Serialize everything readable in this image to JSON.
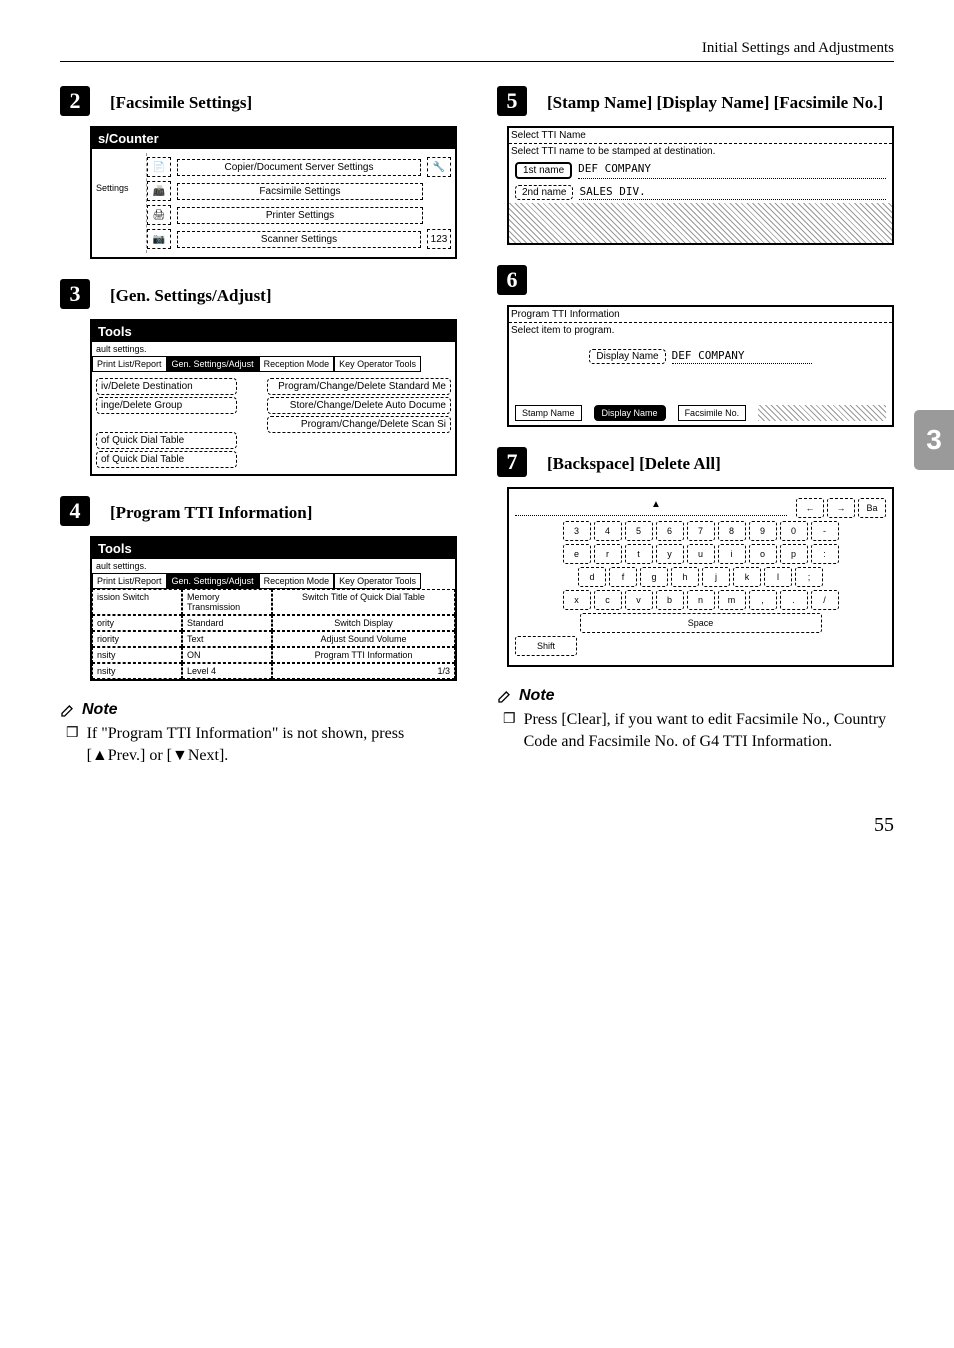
{
  "header": "Initial Settings and Adjustments",
  "side_tab": "3",
  "pagenum": "55",
  "left": {
    "step2": {
      "label": "[Facsimile Settings]"
    },
    "step3": {
      "label": "[Gen. Settings/Adjust]"
    },
    "step4": {
      "label": "[Program TTI Information]"
    },
    "note_title": "Note",
    "note_text": "If \"Program TTI Information\" is not shown, press [▲Prev.] or [▼Next]."
  },
  "right": {
    "step5": {
      "label": "[Stamp Name]  [Display Name]  [Facsimile No.]"
    },
    "step7": {
      "label": "[Backspace]     [Delete All]"
    },
    "note_title": "Note",
    "note_text": "Press [Clear], if you want to edit Facsimile No., Country Code and Facsimile No. of G4 TTI Information."
  },
  "panel_counter": {
    "title": "s/Counter",
    "sidetab": "Settings",
    "rows": [
      {
        "icon": "📄",
        "label": "Copier/Document Server Settings",
        "right": "🔧"
      },
      {
        "icon": "📠",
        "label": "Facsimile Settings",
        "right": ""
      },
      {
        "icon": "🖨",
        "label": "Printer Settings",
        "right": ""
      },
      {
        "icon": "📷",
        "label": "Scanner Settings",
        "right": "123"
      }
    ]
  },
  "panel_tools1": {
    "title": "Tools",
    "subtitle": "ault settings.",
    "tabs": [
      "Print List/Report",
      "Gen. Settings/Adjust",
      "Reception Mode",
      "Key Operator Tools"
    ],
    "active_tab": 1,
    "left_items": [
      "iv/Delete Destination",
      "inge/Delete Group",
      "of Quick Dial Table",
      "of Quick Dial Table"
    ],
    "right_items": [
      "Program/Change/Delete Standard Me",
      "Store/Change/Delete Auto Docume",
      "Program/Change/Delete Scan Si"
    ]
  },
  "panel_tools2": {
    "title": "Tools",
    "subtitle": "ault settings.",
    "tabs": [
      "Print List/Report",
      "Gen. Settings/Adjust",
      "Reception Mode",
      "Key Operator Tools"
    ],
    "active_tab": 1,
    "rows": [
      {
        "l": "ission Switch",
        "m": "Memory Transmission",
        "r": "Switch Title of Quick Dial Table"
      },
      {
        "l": "ority",
        "m": "Standard",
        "r": "Switch Display"
      },
      {
        "l": "riority",
        "m": "Text",
        "r": "Adjust Sound Volume"
      },
      {
        "l": "nsity",
        "m": "ON",
        "r": "Program TTI Information"
      },
      {
        "l": "nsity",
        "m": "Level 4",
        "r": "1/3"
      }
    ]
  },
  "panel_tti_select": {
    "heading": "Select TTI Name",
    "sub": "Select TTI name to be stamped at destination.",
    "options": [
      {
        "label": "1st name",
        "value": "DEF COMPANY",
        "selected": true
      },
      {
        "label": "2nd name",
        "value": "SALES DIV.",
        "selected": false
      }
    ]
  },
  "panel_tti_prog": {
    "heading": "Program TTI Information",
    "sub": "Select item to program.",
    "display_label": "Display Name",
    "display_value": "DEF COMPANY",
    "bottom": [
      "Stamp Name",
      "Display Name",
      "Facsimile No."
    ],
    "active_bottom": 1
  },
  "panel_kbd": {
    "nav": [
      "←",
      "→",
      "Ba"
    ],
    "row1": [
      "3",
      "4",
      "5",
      "6",
      "7",
      "8",
      "9",
      "0",
      "-"
    ],
    "row2": [
      "e",
      "r",
      "t",
      "y",
      "u",
      "i",
      "o",
      "p",
      ":"
    ],
    "row3": [
      "d",
      "f",
      "g",
      "h",
      "j",
      "k",
      "l",
      ";"
    ],
    "row4": [
      "x",
      "c",
      "v",
      "b",
      "n",
      "m",
      ",",
      ".",
      "/"
    ],
    "space": "Space",
    "shift": "Shift"
  }
}
